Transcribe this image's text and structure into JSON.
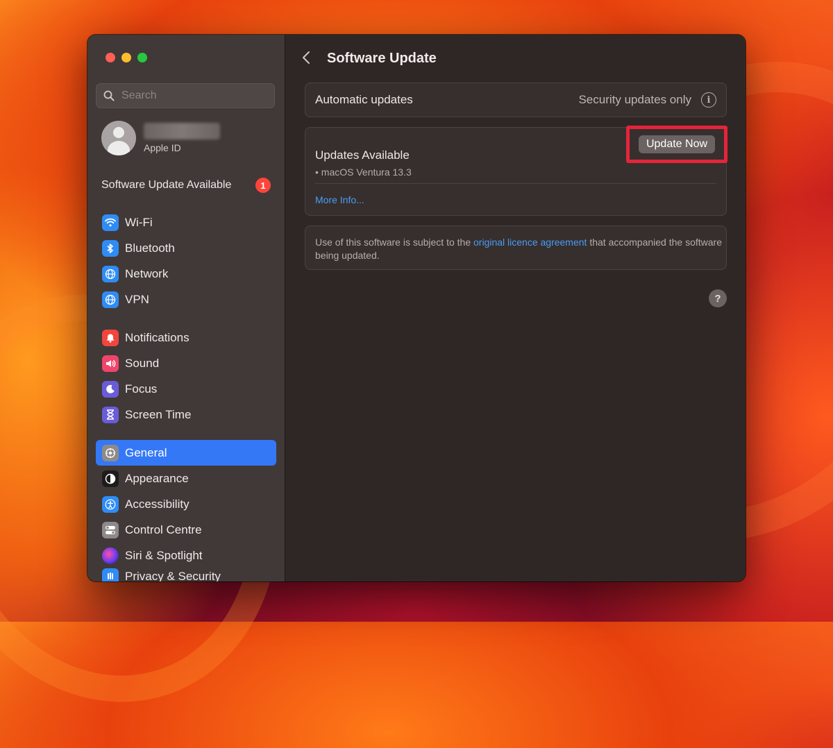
{
  "sidebar": {
    "search_placeholder": "Search",
    "apple_id_label": "Apple ID",
    "software_update_label": "Software Update Available",
    "software_update_badge": "1",
    "network_items": [
      {
        "label": "Wi-Fi",
        "icon": "wifi-icon"
      },
      {
        "label": "Bluetooth",
        "icon": "bluetooth-icon"
      },
      {
        "label": "Network",
        "icon": "globe-icon"
      },
      {
        "label": "VPN",
        "icon": "globe-icon"
      }
    ],
    "notification_items": [
      {
        "label": "Notifications",
        "icon": "bell-icon"
      },
      {
        "label": "Sound",
        "icon": "speaker-icon"
      },
      {
        "label": "Focus",
        "icon": "moon-icon"
      },
      {
        "label": "Screen Time",
        "icon": "hourglass-icon"
      }
    ],
    "general_items": [
      {
        "label": "General",
        "icon": "gear-icon",
        "selected": true
      },
      {
        "label": "Appearance",
        "icon": "appearance-icon"
      },
      {
        "label": "Accessibility",
        "icon": "accessibility-icon"
      },
      {
        "label": "Control Centre",
        "icon": "switches-icon"
      },
      {
        "label": "Siri & Spotlight",
        "icon": "siri-icon"
      },
      {
        "label": "Privacy & Security",
        "icon": "hand-icon"
      }
    ]
  },
  "main": {
    "title": "Software Update",
    "automatic": {
      "label": "Automatic updates",
      "value": "Security updates only"
    },
    "updates": {
      "title": "Updates Available",
      "button": "Update Now",
      "item": "• macOS Ventura 13.3",
      "more_info": "More Info..."
    },
    "licence": {
      "prefix": "Use of this software is subject to the ",
      "link": "original licence agreement",
      "suffix": " that accompanied the software being updated."
    },
    "help": "?"
  },
  "colors": {
    "accent": "#3478f6",
    "highlight_border": "#e5243b",
    "badge": "#ff453a",
    "link": "#4a9cf5"
  }
}
